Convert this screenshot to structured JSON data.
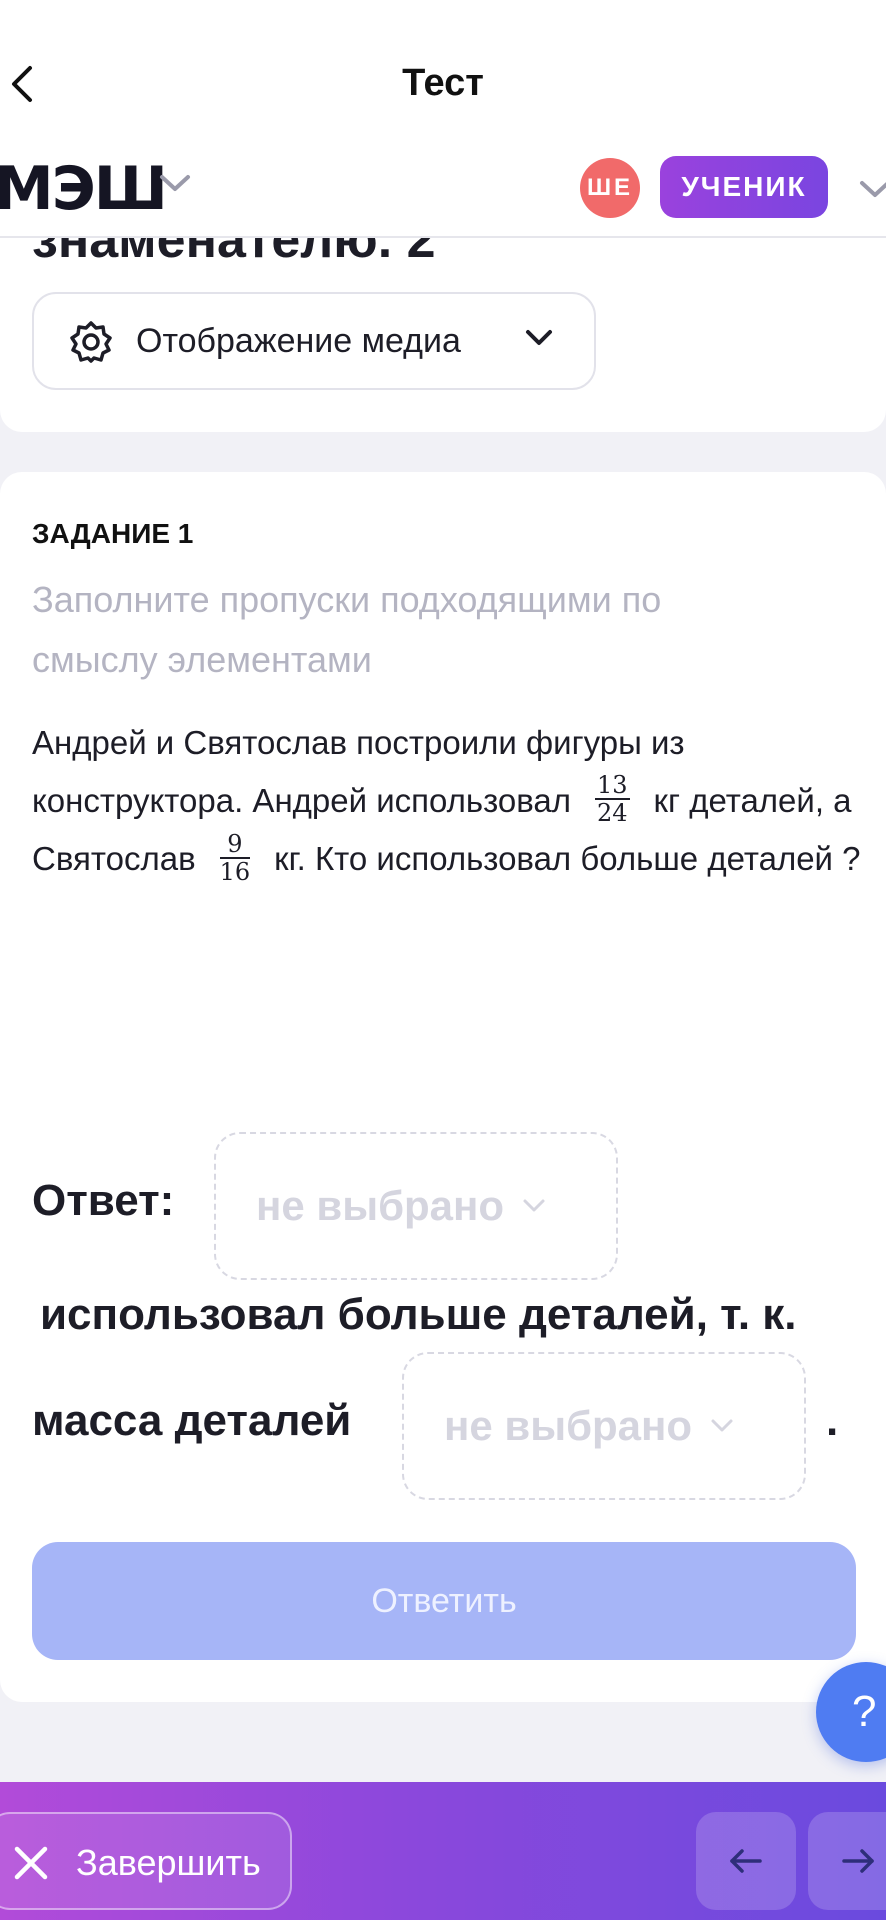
{
  "header": {
    "title": "Тест"
  },
  "appbar": {
    "logo": "МЭШ",
    "avatar_initials": "ШЕ",
    "role_label": "УЧЕНИК"
  },
  "media": {
    "partial_heading": "знаменателю. 2",
    "button_label": "Отображение медиа"
  },
  "task": {
    "label": "ЗАДАНИЕ 1",
    "instruction": "Заполните пропуски подходящими по смыслу элементами",
    "text_part1": "Андрей и Святослав построили фигуры из конструктора. Андрей использовал",
    "frac1_num": "13",
    "frac1_den": "24",
    "text_part2": "кг деталей, а Святослав",
    "frac2_num": "9",
    "frac2_den": "16",
    "text_part3": "кг. Кто использовал больше деталей ?",
    "answer_label": "Ответ:",
    "dropdown1_placeholder": "не выбрано",
    "line2": "использовал больше деталей, т. к.",
    "line3": "масса деталей",
    "dropdown2_placeholder": "не выбрано",
    "end_dot": ".",
    "submit_label": "Ответить"
  },
  "help": {
    "label": "?"
  },
  "footer": {
    "finish_label": "Завершить"
  },
  "colors": {
    "accent": "#8c48dc",
    "submit_disabled": "#a6b5f7",
    "help": "#4f7cf2",
    "avatar": "#f16a6a"
  }
}
